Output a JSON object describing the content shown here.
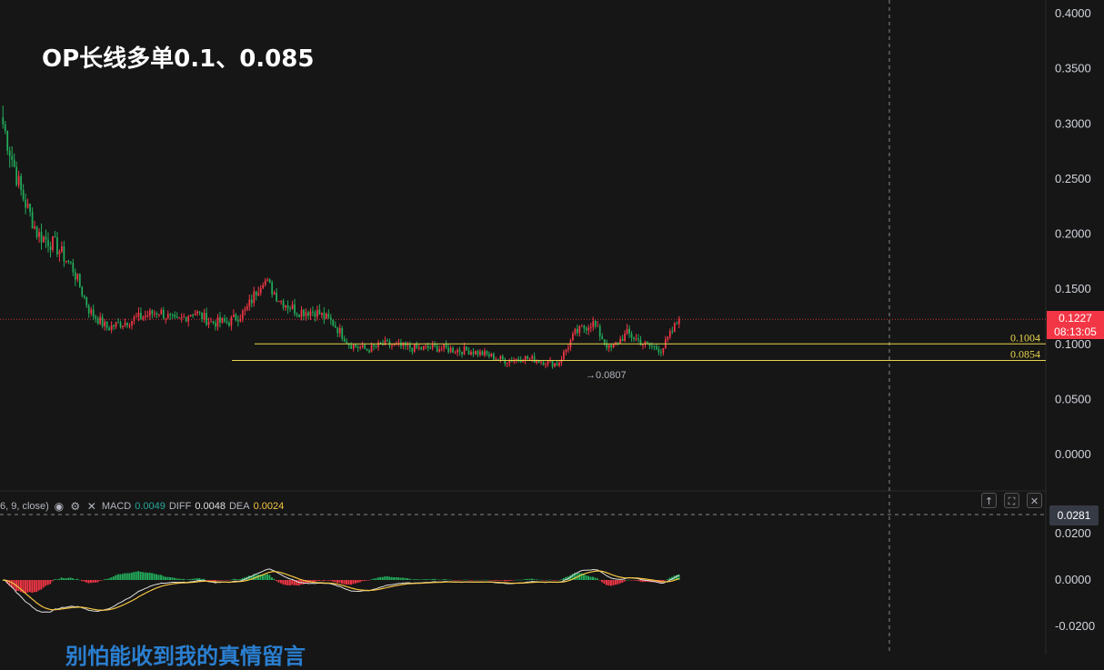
{
  "title": "OP长线多单0.1、0.085",
  "watermark_text": "别怕能收到我的真情留言",
  "colors": {
    "background": "#161616",
    "up": "#f23645",
    "down": "#22ab5a",
    "hline": "#e8d44d",
    "macd_line": "#e0e0e0",
    "signal_line": "#f5c542",
    "last_price": "#f23645"
  },
  "price_axis": {
    "ticks": [
      "0.4000",
      "0.3500",
      "0.3000",
      "0.2500",
      "0.2000",
      "0.1500",
      "0.1000",
      "0.0500",
      "0.0000"
    ]
  },
  "last_price": {
    "value": "0.1227",
    "countdown": "08:13:05"
  },
  "levels": [
    {
      "label": "0.1004",
      "value": 0.1004
    },
    {
      "label": "0.0854",
      "value": 0.0854
    }
  ],
  "low_marker": "→0.0807",
  "macd": {
    "legend_prefix": "6, 9, close)",
    "macd_label": "MACD",
    "macd_value": "0.0049",
    "diff_label": "DIFF",
    "diff_value": "0.0048",
    "dea_label": "DEA",
    "dea_value": "0.0024",
    "crosshair_value": "0.0281",
    "ticks": [
      "0.0200",
      "0.0000",
      "-0.0200"
    ]
  },
  "chart_data": {
    "type": "candlestick",
    "title": "OP长线多单0.1、0.085",
    "ylim": [
      0,
      0.4
    ],
    "anchor_closes": [
      0.3,
      0.24,
      0.2,
      0.19,
      0.17,
      0.13,
      0.115,
      0.12,
      0.125,
      0.13,
      0.12,
      0.13,
      0.12,
      0.12,
      0.13,
      0.16,
      0.14,
      0.13,
      0.13,
      0.12,
      0.1,
      0.095,
      0.1,
      0.098,
      0.096,
      0.097,
      0.095,
      0.094,
      0.09,
      0.085,
      0.088,
      0.085,
      0.082,
      0.11,
      0.12,
      0.095,
      0.11,
      0.1,
      0.095,
      0.1227
    ],
    "horizontal_levels": [
      0.1004,
      0.0854
    ],
    "recent_low": 0.0807,
    "last": 0.1227,
    "macd_ylim": [
      -0.03,
      0.03
    ],
    "macd_last": {
      "macd": 0.0049,
      "diff": 0.0048,
      "dea": 0.0024
    }
  }
}
